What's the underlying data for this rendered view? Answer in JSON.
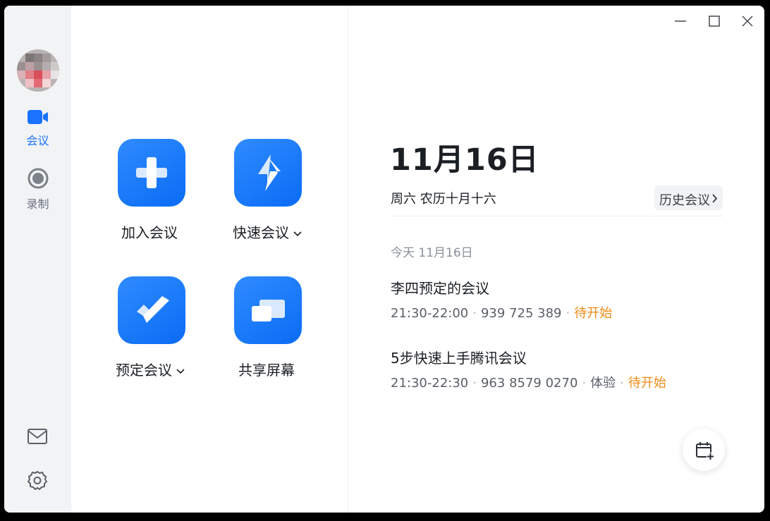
{
  "sidebar": {
    "items": [
      {
        "label": "会议",
        "icon": "video-camera-icon",
        "active": true
      },
      {
        "label": "录制",
        "icon": "record-icon",
        "active": false
      }
    ],
    "bottom_icons": [
      "mail-icon",
      "settings-gear-icon"
    ]
  },
  "window_controls": [
    "minimize-icon",
    "maximize-icon",
    "close-icon"
  ],
  "actions": {
    "join": {
      "label": "加入会议",
      "icon": "plus-icon"
    },
    "quick": {
      "label": "快速会议",
      "icon": "lightning-icon",
      "has_dropdown": true
    },
    "schedule": {
      "label": "预定会议",
      "icon": "checkmark-icon",
      "has_dropdown": true
    },
    "share": {
      "label": "共享屏幕",
      "icon": "share-screen-icon"
    }
  },
  "schedule_panel": {
    "date": "11月16日",
    "weekday_lunar": "周六 农历十月十六",
    "history_button": "历史会议",
    "section_header": "今天 11月16日",
    "meetings": [
      {
        "title": "李四预定的会议",
        "time": "21:30-22:00",
        "id": "939 725 389",
        "tag": "",
        "status": "待开始"
      },
      {
        "title": "5步快速上手腾讯会议",
        "time": "21:30-22:30",
        "id": "963 8579 0270",
        "tag": "体验",
        "status": "待开始"
      }
    ]
  },
  "colors": {
    "accent": "#1a73ff",
    "status_pending": "#f08a14",
    "sidebar_bg": "#f2f3f5"
  },
  "fab_icon": "add-calendar-icon"
}
